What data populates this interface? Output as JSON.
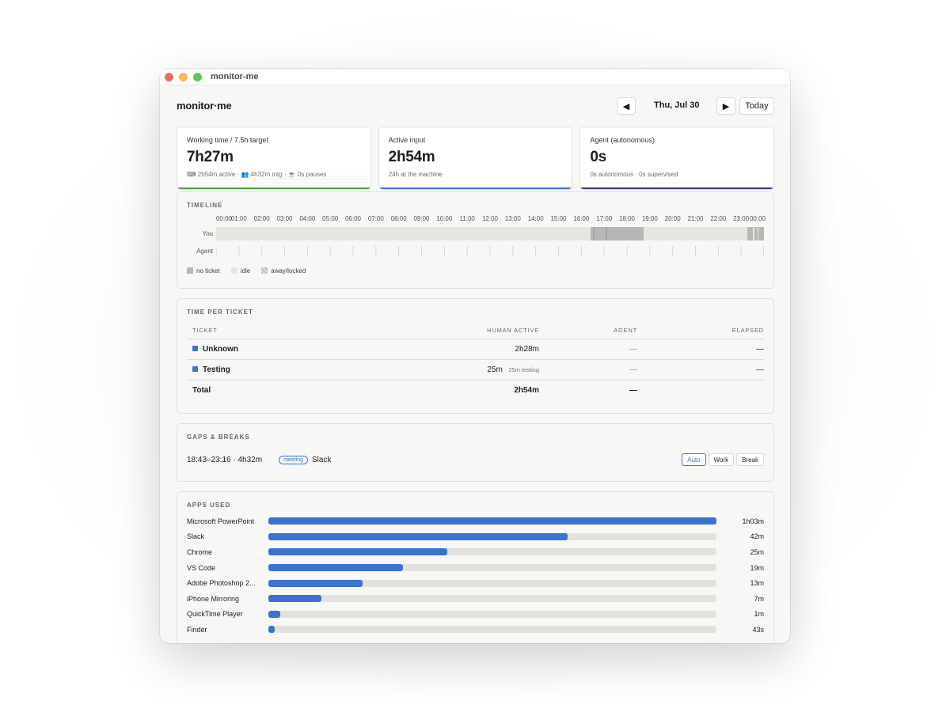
{
  "window": {
    "title": "monitor-me"
  },
  "header": {
    "brand": "monitor·me",
    "prev": "◀",
    "date": "Thu, Jul 30",
    "next": "▶",
    "today": "Today"
  },
  "cards": [
    {
      "label": "Working time / 7.5h target",
      "value": "7h27m",
      "sub": "⌨ 2h54m active · 👥 4h32m mtg · ☕ 0s pauses",
      "accent": "#4aa53a"
    },
    {
      "label": "Active input",
      "value": "2h54m",
      "sub": "24h at the machine",
      "accent": "#3d72cf"
    },
    {
      "label": "Agent (autonomous)",
      "value": "0s",
      "sub": "0s autonomous · 0s supervised",
      "accent": "#3b2f8f"
    }
  ],
  "timeline": {
    "title": "TIMELINE",
    "hours": [
      "00:00",
      "01:00",
      "02:00",
      "03:00",
      "04:00",
      "05:00",
      "06:00",
      "07:00",
      "08:00",
      "09:00",
      "10:00",
      "11:00",
      "12:00",
      "13:00",
      "14:00",
      "15:00",
      "16:00",
      "17:00",
      "18:00",
      "19:00",
      "20:00",
      "21:00",
      "22:00",
      "23:00",
      "00:00"
    ],
    "rows": {
      "you": "You",
      "agent": "Agent"
    },
    "legend": {
      "no_ticket": "no ticket",
      "idle": "idle",
      "away": "away/locked"
    }
  },
  "tickets": {
    "title": "TIME PER TICKET",
    "headers": {
      "ticket": "TICKET",
      "human": "HUMAN ACTIVE",
      "agent": "AGENT",
      "elapsed": "ELAPSED"
    },
    "rows": [
      {
        "name": "Unknown",
        "human": "2h28m",
        "human_note": "",
        "agent": "—",
        "elapsed": "—"
      },
      {
        "name": "Testing",
        "human": "25m",
        "human_note": "· 25m testing",
        "agent": "—",
        "elapsed": "—"
      }
    ],
    "total": {
      "label": "Total",
      "human": "2h54m",
      "agent": "—"
    }
  },
  "gaps": {
    "title": "GAPS & BREAKS",
    "range": "18:43–23:16 · 4h32m",
    "tag": "meeting",
    "app": "Slack",
    "options": [
      "Auto",
      "Work",
      "Break"
    ]
  },
  "apps": {
    "title": "APPS USED",
    "items": [
      {
        "name": "Microsoft PowerPoint",
        "time": "1h03m",
        "frac": 1.0
      },
      {
        "name": "Slack",
        "time": "42m",
        "frac": 0.667
      },
      {
        "name": "Chrome",
        "time": "25m",
        "frac": 0.4
      },
      {
        "name": "VS Code",
        "time": "19m",
        "frac": 0.3
      },
      {
        "name": "Adobe Photoshop 2...",
        "time": "13m",
        "frac": 0.21
      },
      {
        "name": "iPhone Mirroring",
        "time": "7m",
        "frac": 0.118
      },
      {
        "name": "QuickTime Player",
        "time": "1m",
        "frac": 0.027
      },
      {
        "name": "Finder",
        "time": "43s",
        "frac": 0.012
      }
    ]
  }
}
